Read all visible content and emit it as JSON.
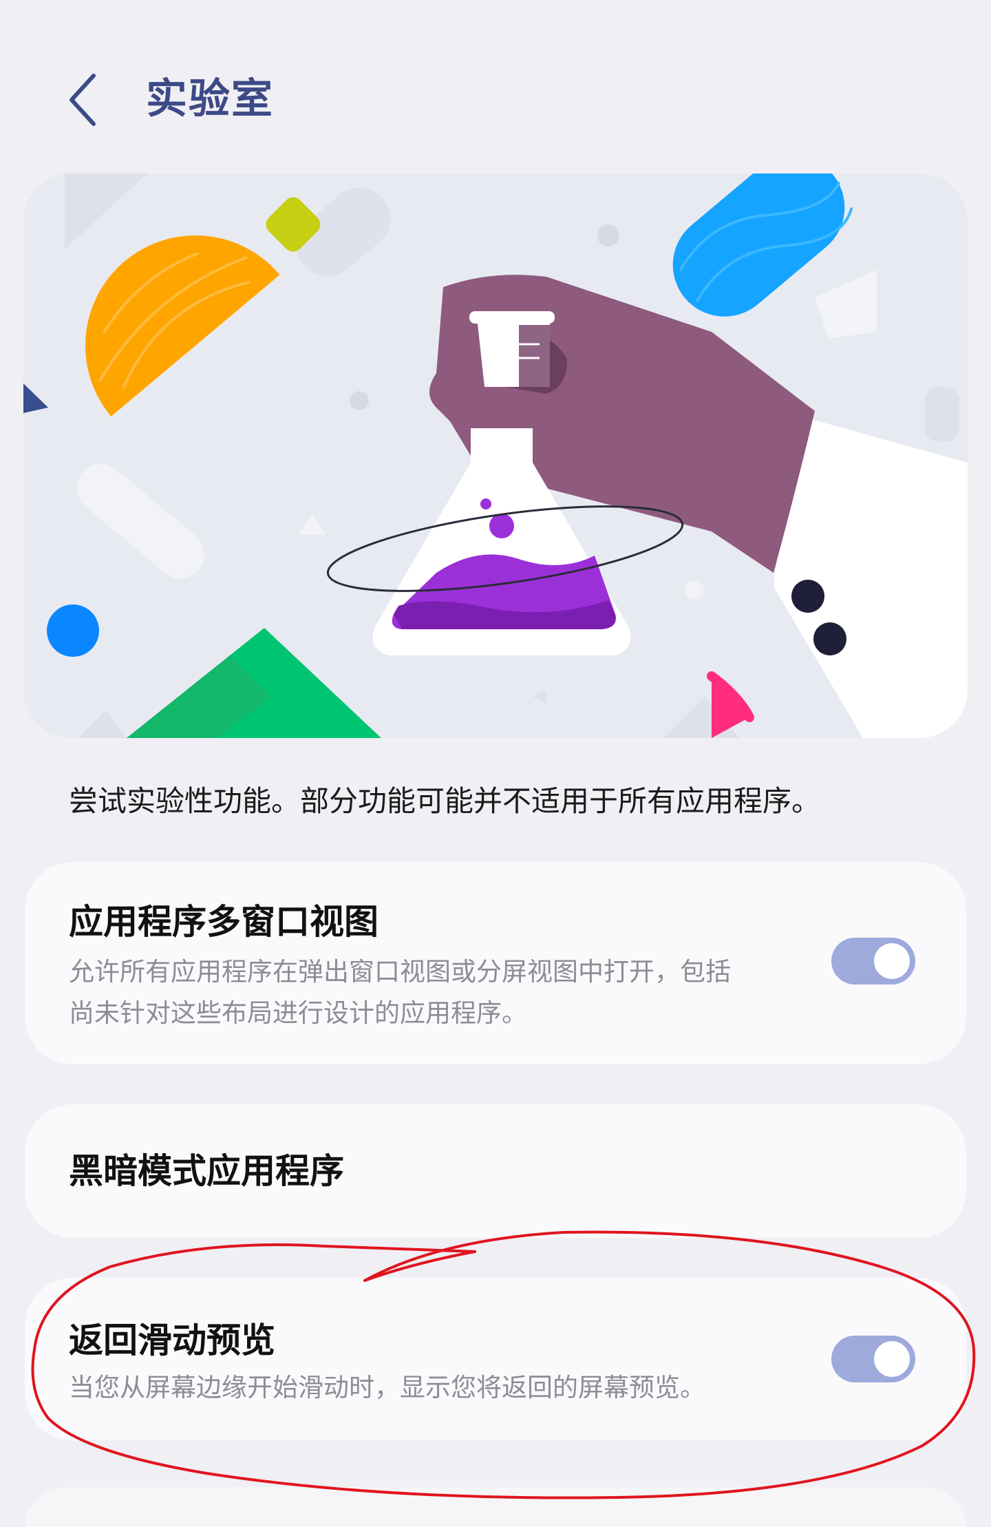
{
  "header": {
    "back_icon": "chevron-left-icon",
    "title": "实验室"
  },
  "intro": {
    "text": "尝试实验性功能。部分功能可能并不适用于所有应用程序。"
  },
  "settings": [
    {
      "title": "应用程序多窗口视图",
      "description_line1": "允许所有应用程序在弹出窗口视图或分屏视图中打开，包括",
      "description_line2": "尚未针对这些布局进行设计的应用程序。",
      "toggle_on": true
    },
    {
      "title": "黑暗模式应用程序"
    },
    {
      "title": "返回滑动预览",
      "description": "当您从屏幕边缘开始滑动时，显示您将返回的屏幕预览。",
      "toggle_on": true
    }
  ],
  "colors": {
    "title_accent": "#3d4a87",
    "toggle_on": "#9ea9dc",
    "annotation_circle": "#e0141e"
  }
}
